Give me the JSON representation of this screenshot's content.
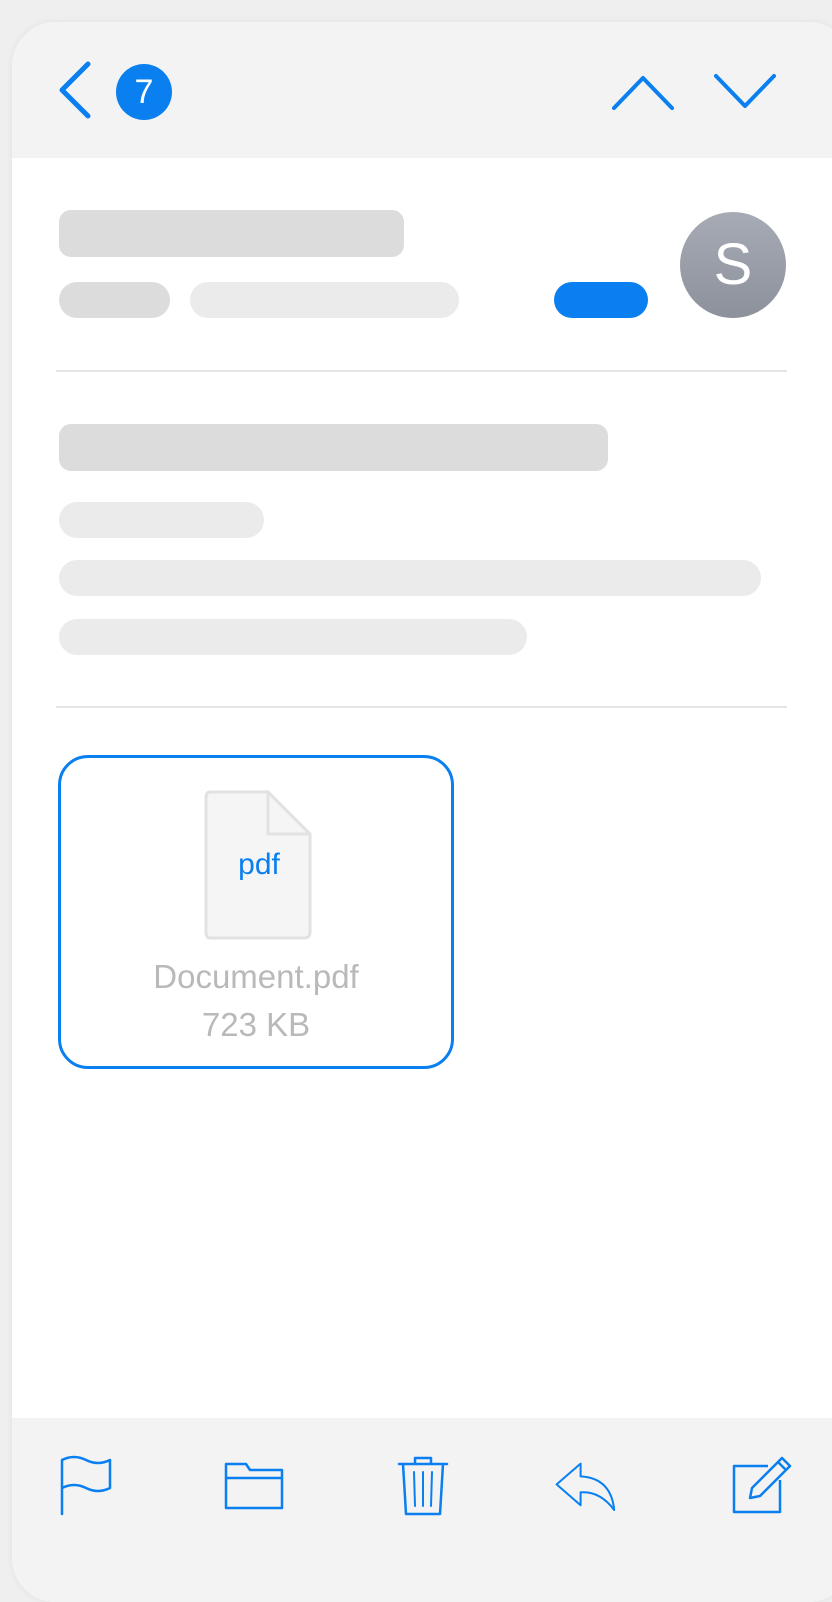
{
  "header": {
    "back_icon": "chevron-left-icon",
    "unread_count": "7",
    "prev_icon": "chevron-up-icon",
    "next_icon": "chevron-down-icon"
  },
  "sender": {
    "avatar_initial": "S"
  },
  "attachment": {
    "extension": "pdf",
    "file_name": "Document.pdf",
    "file_size": "723 KB"
  },
  "toolbar": {
    "items": [
      "flag-icon",
      "folder-icon",
      "trash-icon",
      "reply-icon",
      "compose-icon"
    ]
  },
  "colors": {
    "accent": "#0a7ff0",
    "bar_background": "#f3f3f4",
    "skeleton_dark": "#dcdcdc",
    "skeleton_light": "#ebebeb",
    "avatar": "#9a9ea8",
    "muted_text": "#b9b9b9"
  }
}
